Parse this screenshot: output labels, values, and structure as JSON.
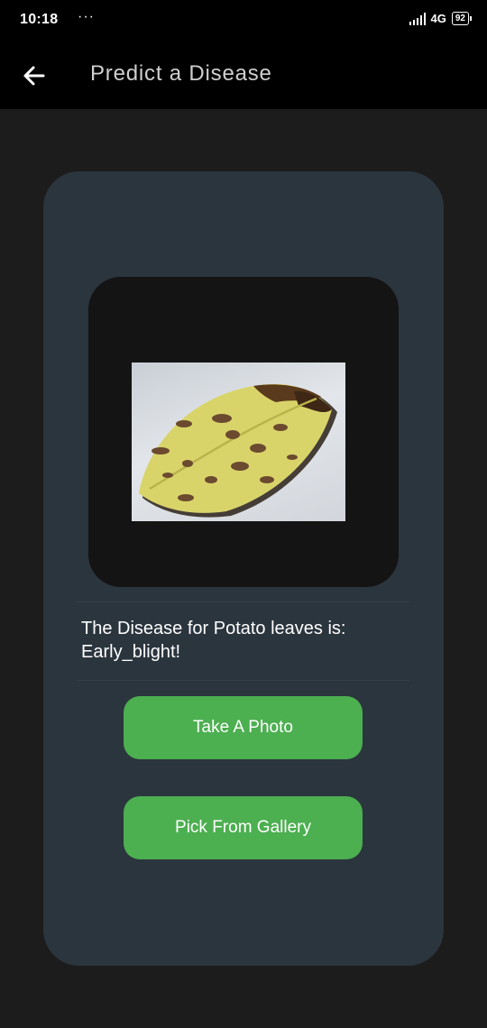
{
  "status_bar": {
    "time": "10:18",
    "dots": "···",
    "network": "4G",
    "battery": "92"
  },
  "app_bar": {
    "title": "Predict a Disease"
  },
  "result": {
    "text": "The Disease for Potato leaves  is: Early_blight!"
  },
  "buttons": {
    "take_photo": "Take A Photo",
    "pick_gallery": "Pick From Gallery"
  },
  "colors": {
    "card": "#2b353e",
    "accent": "#4caf50",
    "background": "#1c1c1c",
    "appbar": "#000000"
  },
  "icons": {
    "back": "arrow-left-icon",
    "signal": "signal-icon",
    "battery": "battery-icon"
  }
}
